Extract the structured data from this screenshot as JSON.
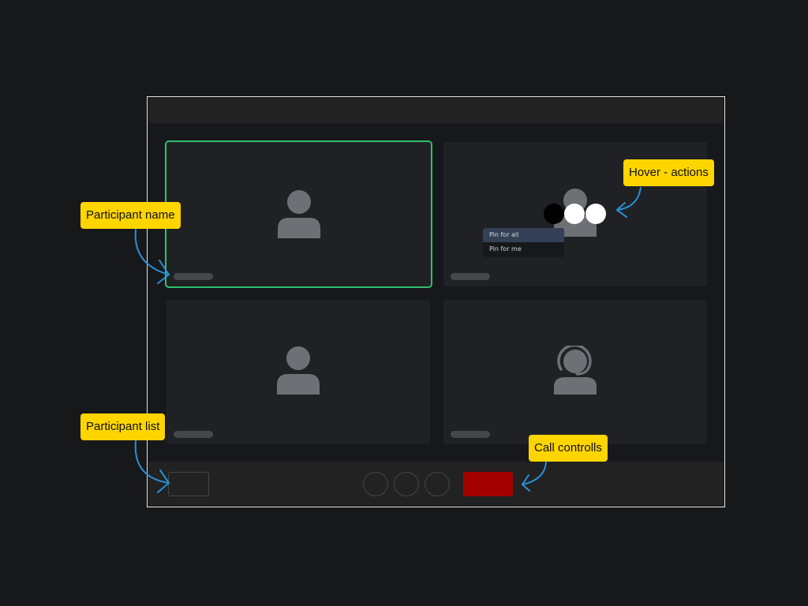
{
  "annotations": {
    "participant_name": "Participant name",
    "participant_list": "Participant list",
    "hover_actions": "Hover - actions",
    "call_controls": "Call controlls"
  },
  "colors": {
    "active_speaker_border": "#2fbf6b",
    "end_call": "#a50000",
    "callout": "#ffd500",
    "arrow": "#2a8fd8"
  },
  "tiles": [
    {
      "icon": "person-icon",
      "active": true
    },
    {
      "icon": "person-icon",
      "active": false,
      "hovered": true
    },
    {
      "icon": "person-icon",
      "active": false
    },
    {
      "icon": "support-agent-icon",
      "active": false
    }
  ],
  "pin_menu": {
    "items": [
      "Pin for all",
      "Pin for me"
    ],
    "highlighted": "Pin for all"
  }
}
